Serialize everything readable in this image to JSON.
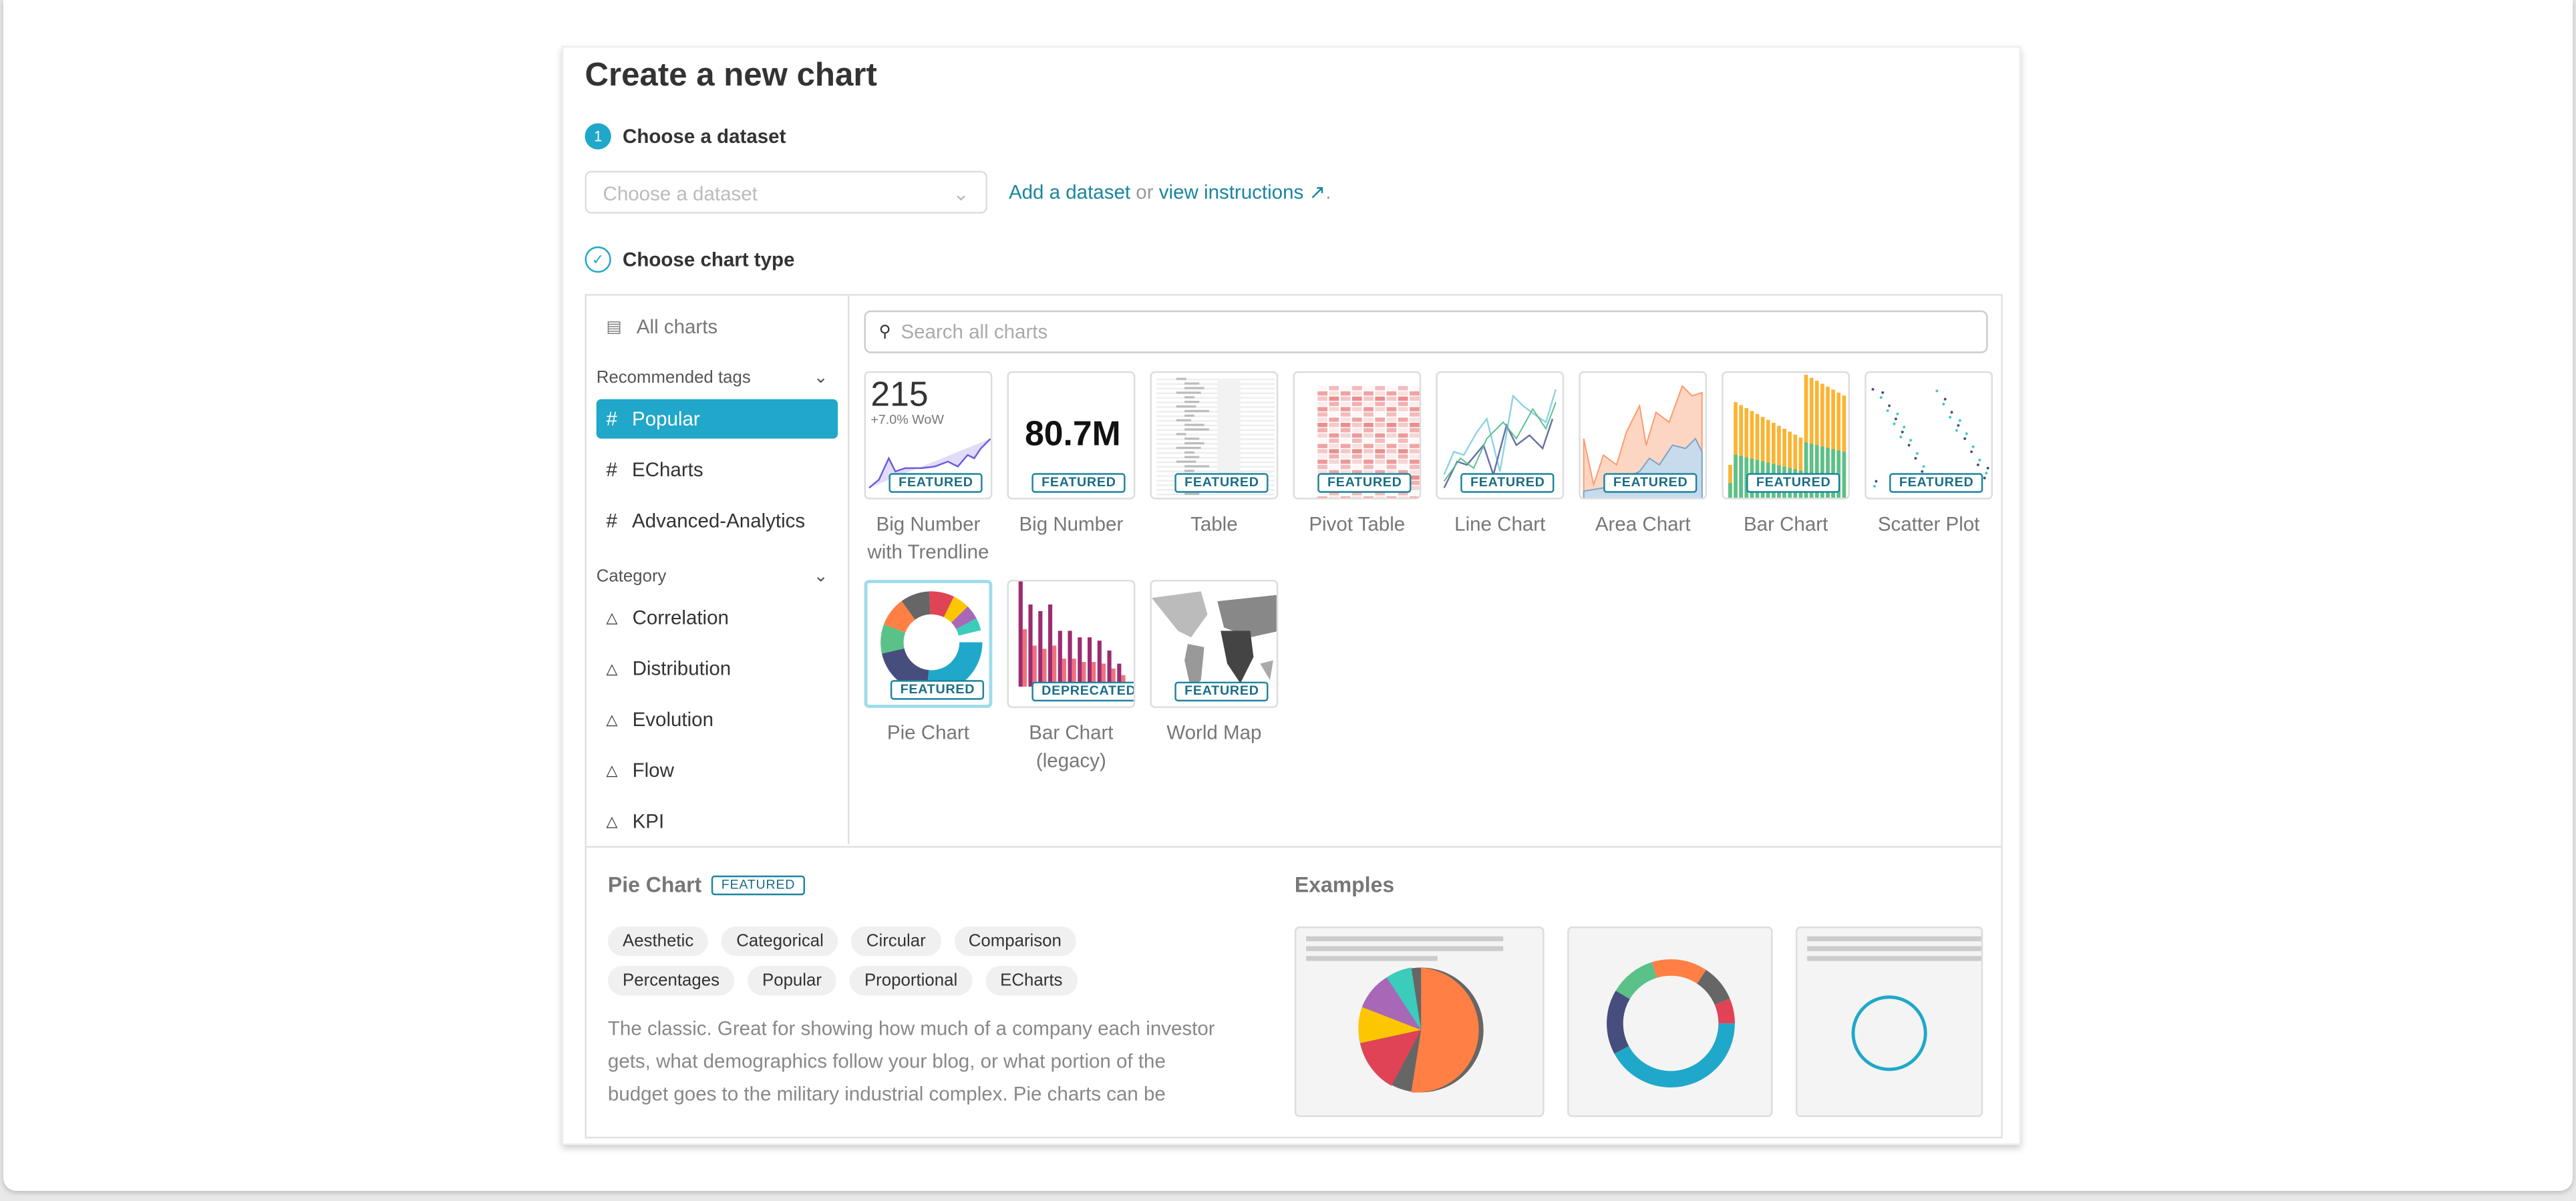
{
  "title": "Create a new chart",
  "step1": {
    "number": "1",
    "label": "Choose a dataset",
    "placeholder": "Choose a dataset",
    "add_link": "Add a dataset",
    "or": "or",
    "instructions_link": "view instructions",
    "period": "."
  },
  "step2": {
    "label": "Choose chart type"
  },
  "sidebar": {
    "all_charts": "All charts",
    "recommended_header": "Recommended tags",
    "recommended": [
      "Popular",
      "ECharts",
      "Advanced-Analytics"
    ],
    "category_header": "Category",
    "categories": [
      "Correlation",
      "Distribution",
      "Evolution",
      "Flow",
      "KPI"
    ]
  },
  "search": {
    "placeholder": "Search all charts"
  },
  "charts": [
    {
      "name": "Big Number with Trendline",
      "badge": "FEATURED",
      "preview_value": "215",
      "preview_sub": "+7.0% WoW"
    },
    {
      "name": "Big Number",
      "badge": "FEATURED",
      "preview_value": "80.7M"
    },
    {
      "name": "Table",
      "badge": "FEATURED"
    },
    {
      "name": "Pivot Table",
      "badge": "FEATURED"
    },
    {
      "name": "Line Chart",
      "badge": "FEATURED"
    },
    {
      "name": "Area Chart",
      "badge": "FEATURED"
    },
    {
      "name": "Bar Chart",
      "badge": "FEATURED"
    },
    {
      "name": "Scatter Plot",
      "badge": "FEATURED"
    },
    {
      "name": "Pie Chart",
      "badge": "FEATURED",
      "selected": true
    },
    {
      "name": "Bar Chart (legacy)",
      "badge": "DEPRECATED"
    },
    {
      "name": "World Map",
      "badge": "FEATURED"
    }
  ],
  "detail": {
    "name": "Pie Chart",
    "badge": "FEATURED",
    "tags": [
      "Aesthetic",
      "Categorical",
      "Circular",
      "Comparison",
      "Percentages",
      "Popular",
      "Proportional",
      "ECharts"
    ],
    "description": "The classic. Great for showing how much of a company each investor gets, what demographics follow your blog, or what portion of the budget goes to the military industrial complex. Pie charts can be difficult to interpret precisely. If clarity of relative proportion is",
    "examples_label": "Examples"
  },
  "colors": {
    "accent": "#20a7c9",
    "link": "#1a85a0"
  }
}
